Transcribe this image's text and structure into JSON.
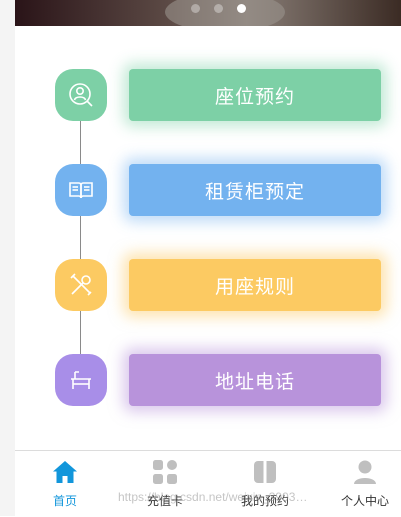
{
  "banner": {
    "slide_count": 3,
    "active_slide": 3
  },
  "menu": [
    {
      "label": "座位预约",
      "color": "#7dd0a6",
      "icon": "person-search-icon"
    },
    {
      "label": "租赁柜预定",
      "color": "#73b2ef",
      "icon": "book-icon"
    },
    {
      "label": "用座规则",
      "color": "#fcca62",
      "icon": "tools-icon"
    },
    {
      "label": "地址电话",
      "color": "#b893db",
      "icon": "desk-icon"
    }
  ],
  "tabbar": {
    "active_color": "#1296db",
    "items": [
      {
        "label": "首页",
        "icon": "home-icon"
      },
      {
        "label": "充值卡",
        "icon": "grid-icon"
      },
      {
        "label": "我的预约",
        "icon": "bookings-icon"
      },
      {
        "label": "个人中心",
        "icon": "user-icon"
      }
    ]
  },
  "watermark": "https://blog.csdn.net/weixin_3993…"
}
